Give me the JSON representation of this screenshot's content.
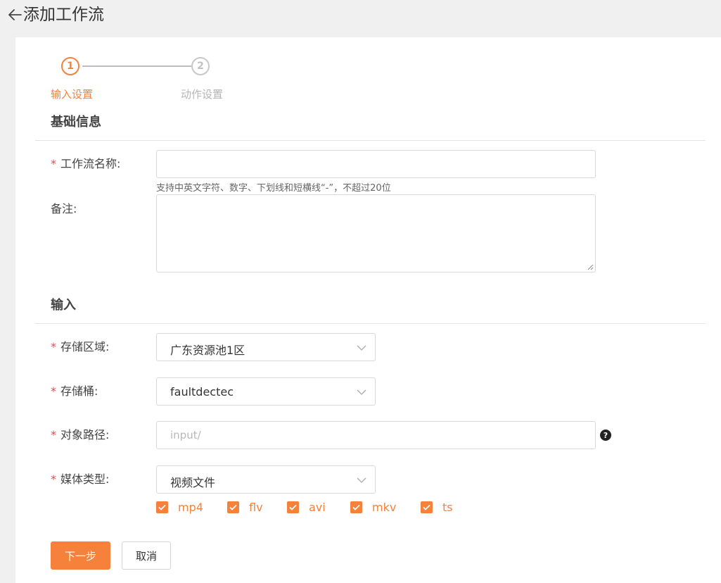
{
  "header": {
    "title": "添加工作流"
  },
  "steps": [
    {
      "number": "1",
      "label": "输入设置",
      "state": "active"
    },
    {
      "number": "2",
      "label": "动作设置",
      "state": "inactive"
    }
  ],
  "basic_info": {
    "title": "基础信息",
    "name_field": {
      "required_mark": "*",
      "label": "工作流名称:",
      "value": "",
      "hint": "支持中英文字符、数字、下划线和短横线“-”，不超过20位"
    },
    "remark_field": {
      "label": "备注:",
      "value": ""
    }
  },
  "input_section": {
    "title": "输入",
    "region": {
      "required_mark": "*",
      "label": "存储区域:",
      "value": "广东资源池1区"
    },
    "bucket": {
      "required_mark": "*",
      "label": "存储桶:",
      "value": "faultdectec"
    },
    "object_path": {
      "required_mark": "*",
      "label": "对象路径:",
      "placeholder": "input/",
      "value": "",
      "help": "?"
    },
    "media_type": {
      "required_mark": "*",
      "label": "媒体类型:",
      "value": "视频文件"
    },
    "formats": [
      {
        "label": "mp4",
        "checked": true
      },
      {
        "label": "flv",
        "checked": true
      },
      {
        "label": "avi",
        "checked": true
      },
      {
        "label": "mkv",
        "checked": true
      },
      {
        "label": "ts",
        "checked": true
      }
    ]
  },
  "actions": {
    "next_label": "下一步",
    "cancel_label": "取消"
  },
  "colors": {
    "accent": "#f5813a",
    "required": "#e5484d"
  }
}
